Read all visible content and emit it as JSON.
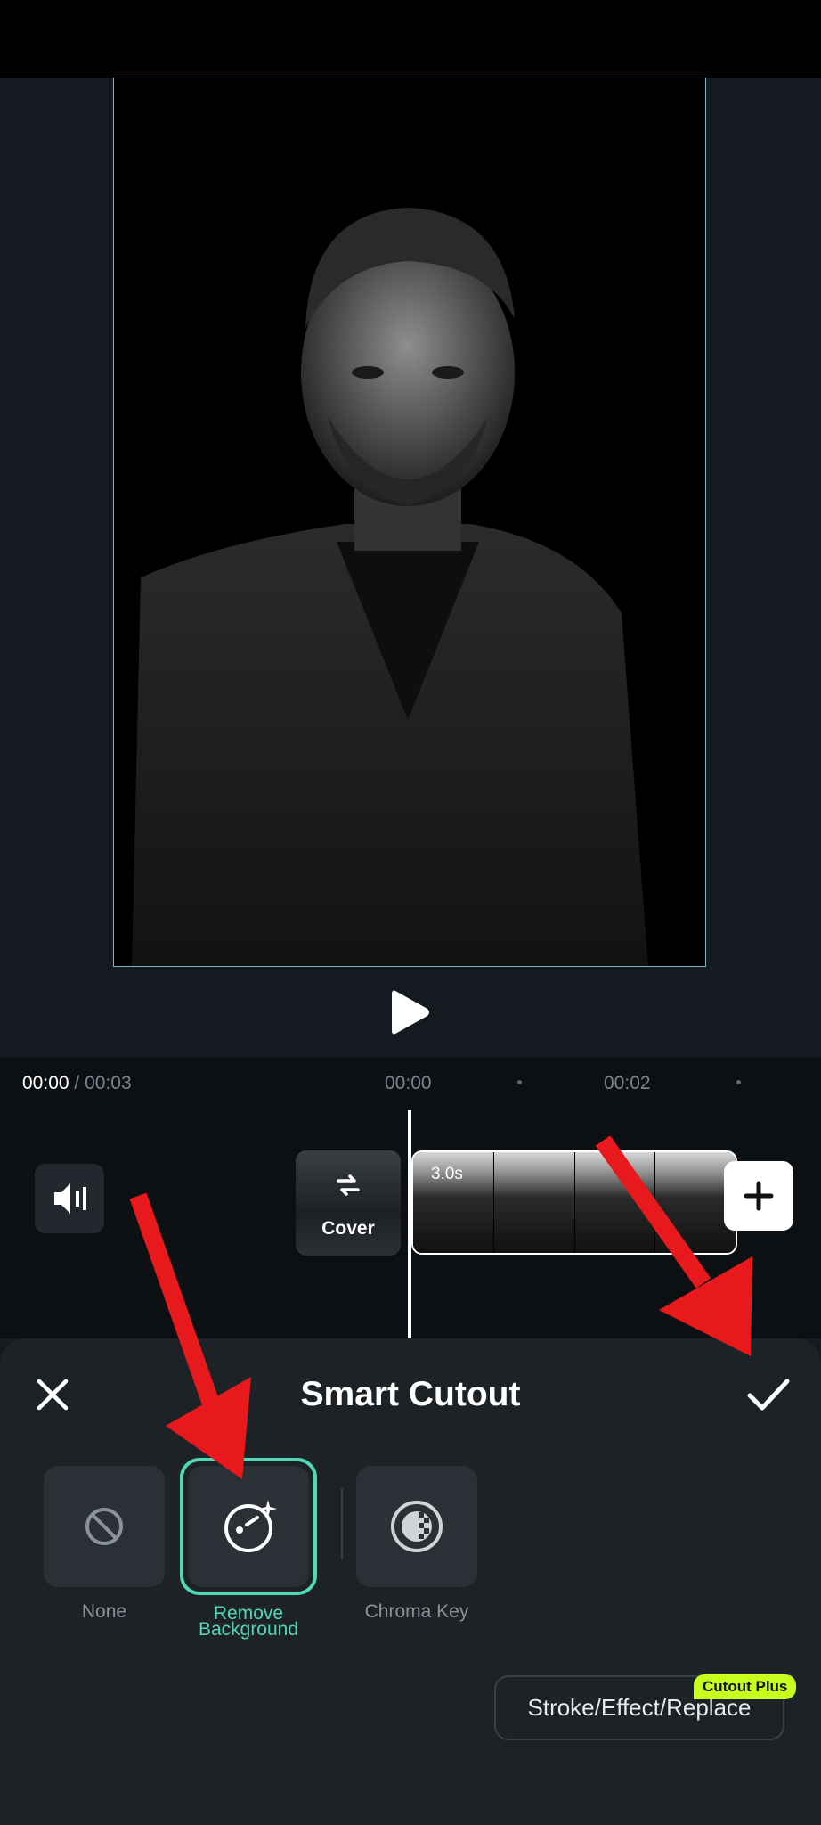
{
  "player": {
    "current_time": "00:00",
    "total_time": "/ 00:03"
  },
  "ruler": {
    "ticks": [
      "00:00",
      "00:02"
    ]
  },
  "timeline": {
    "cover_label": "Cover",
    "clip_duration": "3.0s"
  },
  "panel": {
    "title": "Smart Cutout",
    "options": [
      {
        "label": "None",
        "selected": false
      },
      {
        "label_line1": "Remove",
        "label_line2": "Background",
        "selected": true
      },
      {
        "label": "Chroma Key",
        "selected": false
      }
    ],
    "stroke_button": "Stroke/Effect/Replace",
    "badge": "Cutout Plus"
  },
  "colors": {
    "accent": "#4fd8b6",
    "badge": "#c6ff1d",
    "arrow": "#e8191c",
    "panel_bg": "#1d2226"
  }
}
